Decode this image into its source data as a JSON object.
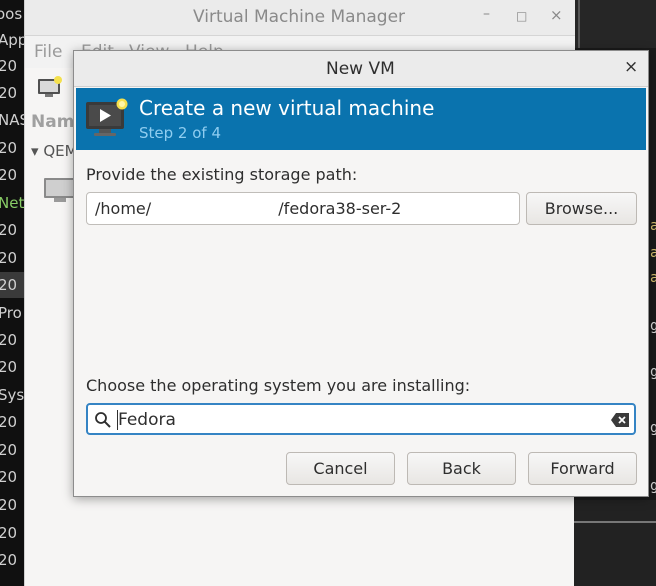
{
  "background_left": {
    "lines": [
      "oos",
      "App",
      "20",
      "20",
      "NAS",
      "20",
      "20",
      "Net",
      "20",
      "20",
      "20",
      "Pro",
      "20",
      "20",
      "Sys",
      "20",
      "20",
      "20",
      "20",
      "20",
      "20"
    ]
  },
  "background_right": {
    "fragments": [
      "a",
      "a",
      "a",
      "g",
      "g",
      "g",
      "g"
    ]
  },
  "vmm": {
    "title": "Virtual Machine Manager",
    "minimize": "–",
    "maximize": "□",
    "close": "×",
    "menu_file": "File",
    "menu_edit_fragment": "Edit",
    "menu_view_fragment": "View",
    "menu_help_fragment": "Help",
    "name_column": "Name",
    "connection": "QEM"
  },
  "dialog": {
    "title": "New VM",
    "close": "×",
    "banner_title": "Create a new virtual machine",
    "banner_step": "Step 2 of 4",
    "storage_label": "Provide the existing storage path:",
    "storage_path": "/home/                         /fedora38-ser-2",
    "browse_label": "Browse...",
    "os_label": "Choose the operating system you are installing:",
    "os_search_value": "Fedora",
    "cancel_label": "Cancel",
    "back_label": "Back",
    "forward_label": "Forward"
  },
  "colors": {
    "banner": "#0a73ae",
    "banner_step": "#8fcdf0",
    "focus_border": "#3584c4"
  }
}
